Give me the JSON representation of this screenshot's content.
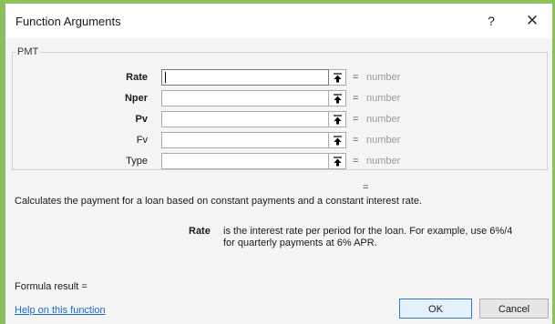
{
  "dialog": {
    "title": "Function Arguments",
    "help_glyph": "?",
    "close_glyph": "✕"
  },
  "function_name": "PMT",
  "arguments": [
    {
      "label": "Rate",
      "value": "",
      "result_eq": "=",
      "result": "number"
    },
    {
      "label": "Nper",
      "value": "",
      "result_eq": "=",
      "result": "number"
    },
    {
      "label": "Pv",
      "value": "",
      "result_eq": "=",
      "result": "number"
    },
    {
      "label": "Fv",
      "value": "",
      "result_eq": "=",
      "result": "number"
    },
    {
      "label": "Type",
      "value": "",
      "result_eq": "=",
      "result": "number"
    }
  ],
  "function_result_eq": "=",
  "description": "Calculates the payment for a loan based on constant payments and a constant interest rate.",
  "arg_help": {
    "name": "Rate",
    "text": "is the interest rate per period for the loan. For example, use 6%/4 for quarterly payments at 6% APR."
  },
  "formula_result": "Formula result =",
  "help_link": "Help on this function",
  "buttons": {
    "ok": "OK",
    "cancel": "Cancel"
  },
  "icons": {
    "ref": "collapse-dialog-icon"
  }
}
